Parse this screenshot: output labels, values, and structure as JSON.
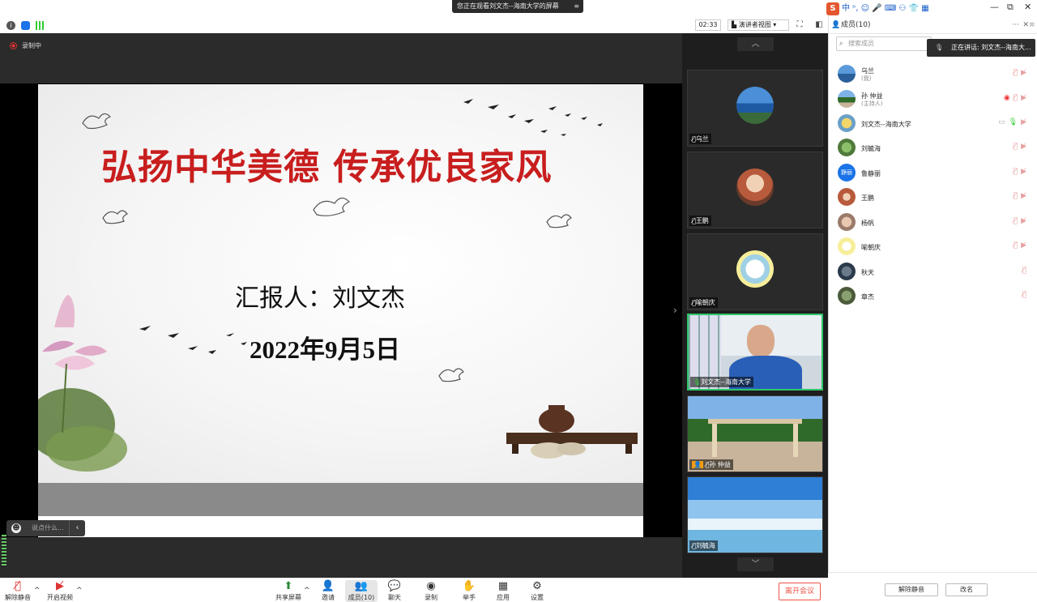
{
  "banner": {
    "text": "您正在观看刘文杰--海南大学的屏幕",
    "icon": "menu-icon"
  },
  "toolbar": {
    "timer": "02:33",
    "view_mode": "演讲者视图",
    "accent": "#1a73e8"
  },
  "stage": {
    "recording_label": "录制中",
    "chat_placeholder": "说点什么..."
  },
  "slide": {
    "title": "弘扬中华美德    传承优良家风",
    "reporter": "汇报人：刘文杰",
    "date": "2022年9月5日",
    "title_color": "#c81e1e"
  },
  "gallery": [
    {
      "name": "乌兰"
    },
    {
      "name": "王鹏"
    },
    {
      "name": "喻朝庆"
    },
    {
      "name": "刘文杰--海南大学"
    },
    {
      "name": "孙 仲益"
    },
    {
      "name": "刘毓海"
    }
  ],
  "bottom": {
    "mute": "解除静音",
    "video": "开启视频",
    "share": "共享屏幕",
    "invite": "邀请",
    "members": "成员(10)",
    "chat": "聊天",
    "record": "录制",
    "raise": "举手",
    "apps": "应用",
    "settings": "设置",
    "leave": "离开会议"
  },
  "panel": {
    "title": "成员(10)",
    "search_placeholder": "搜索成员",
    "speaking": "正在讲话: 刘文杰--海南大...",
    "members": [
      {
        "name": "乌兰",
        "sub": "(我)"
      },
      {
        "name": "孙 仲益",
        "sub": "(主持人)"
      },
      {
        "name": "刘文杰--海南大学",
        "sub": ""
      },
      {
        "name": "刘毓海",
        "sub": ""
      },
      {
        "name": "鲁静丽",
        "sub": ""
      },
      {
        "name": "王鹏",
        "sub": ""
      },
      {
        "name": "杨帆",
        "sub": ""
      },
      {
        "name": "喻朝庆",
        "sub": ""
      },
      {
        "name": "秋天",
        "sub": ""
      },
      {
        "name": "章杰",
        "sub": ""
      }
    ],
    "avatar_text_5": "静丽",
    "unmute_all": "解除静音",
    "rename": "改名"
  },
  "ime": {
    "lang": "中"
  }
}
